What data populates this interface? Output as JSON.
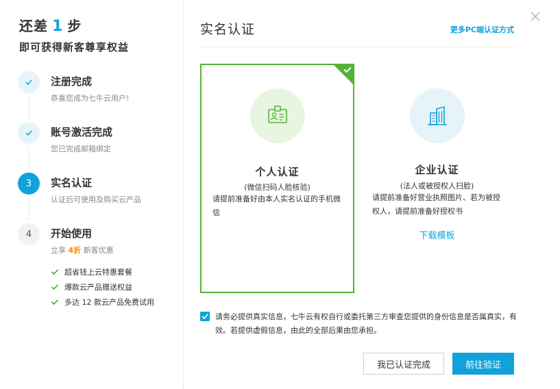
{
  "progress": {
    "prefix": "还差",
    "count": "1",
    "suffix": "步",
    "subtitle": "即可获得新客尊享权益"
  },
  "steps": [
    {
      "marker": "✓",
      "state": "done",
      "title": "注册完成",
      "desc": "恭喜您成为七牛云用户!"
    },
    {
      "marker": "✓",
      "state": "done",
      "title": "账号激活完成",
      "desc": "您已完成邮箱绑定"
    },
    {
      "marker": "3",
      "state": "active",
      "title": "实名认证",
      "desc": "认证后可使用及购买云产品"
    },
    {
      "marker": "4",
      "state": "todo",
      "title": "开始使用",
      "desc_prefix": "立享",
      "desc_highlight": "4折",
      "desc_suffix": "新客优惠"
    }
  ],
  "benefits": [
    "超省钱上云特惠套餐",
    "爆款云产品赠送权益",
    "多达 12 款云产品免费试用"
  ],
  "main": {
    "title": "实名认证",
    "more_link": "更多PC端认证方式"
  },
  "cards": {
    "personal": {
      "icon": "id-badge-icon",
      "title": "个人认证",
      "subtitle": "(微信扫码人脸核验)",
      "description": "请提前准备好由本人实名认证的手机微信",
      "selected": true
    },
    "enterprise": {
      "icon": "building-icon",
      "title": "企业认证",
      "subtitle": "(法人或被授权人扫脸)",
      "description": "请提前准备好营业执照图片、若为被授权人，请提前准备好授权书",
      "link": "下载模板"
    }
  },
  "agreement": {
    "checked": true,
    "text": "请务必提供真实信息，七牛云有权自行或委托第三方审查您提供的身份信息是否属真实，有效。若提供虚假信息，由此的全部后果由您承担。"
  },
  "buttons": {
    "done": "我已认证完成",
    "verify": "前往验证"
  },
  "colors": {
    "accent": "#11a2dc",
    "success": "#52b334",
    "highlight": "#ff8a00"
  }
}
